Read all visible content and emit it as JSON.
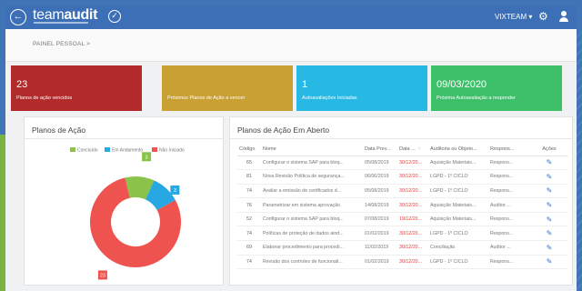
{
  "header": {
    "back_icon": "arrow-left-icon",
    "brand_light": "team",
    "brand_bold": "audit",
    "brand_icon": "check-circle-icon",
    "user_menu": "VIXTEAM ▾",
    "settings_icon": "gear-icon",
    "profile_icon": "person-icon"
  },
  "breadcrumb": "PAINEL PESSOAL >",
  "cards": [
    {
      "number": "23",
      "label": "Planos de ação vencidos",
      "color": "#b32a2a"
    },
    {
      "number": "",
      "label": "Próximos Planos de Ação a vencer",
      "color": "#c9a032"
    },
    {
      "number": "1",
      "label": "Autoavaliações Iniciadas",
      "color": "#27b8e3"
    },
    {
      "number": "09/03/2020",
      "label": "Próxima Autoavaliação a responder",
      "color": "#3ec06b"
    }
  ],
  "chart_panel": {
    "title": "Planos de Ação",
    "chart_data": {
      "type": "donut",
      "series": [
        {
          "name": "Em Andamento",
          "value": 3,
          "color": "#27a8e3"
        },
        {
          "name": "Não Iniciado",
          "value": 23,
          "color": "#ef5350"
        },
        {
          "name": "Concluído",
          "value": 3,
          "color": "#8bc34a"
        }
      ],
      "legend_order": [
        "Concluído",
        "Em Andamento",
        "Não Iniciado"
      ],
      "data_labels": [
        "23",
        "3",
        "3"
      ]
    }
  },
  "table_panel": {
    "title": "Planos de Ação Em Aberto",
    "columns": [
      "Código",
      "Nome",
      "Data Prev...",
      "Data ...",
      "Auditoria ou Objeto...",
      "Respons...",
      "Ações"
    ],
    "action_icon": "edit-pencil-icon",
    "rows": [
      [
        "65",
        "Configurar o sistema SAP para bloq...",
        "05/08/2019",
        "30/12/20...",
        "Aquisição Materiais...",
        "Respons...",
        "✎"
      ],
      [
        "81",
        "Nova Revisão Política de segurança...",
        "06/06/2019",
        "30/12/20...",
        "LGPD - 1º CICLO",
        "Respons...",
        "✎"
      ],
      [
        "74",
        "Avaliar a emissão de certificados d...",
        "05/08/2019",
        "30/12/20...",
        "LGPD - 1º CICLO",
        "Respons...",
        "✎"
      ],
      [
        "76",
        "Parametrizar em sistema aprovação",
        "14/08/2019",
        "30/12/20...",
        "Aquisição Materiais...",
        "Auditor ...",
        "✎"
      ],
      [
        "52",
        "Configurar o sistema SAP para bloq...",
        "07/08/2019",
        "19/12/20...",
        "Aquisição Materiais...",
        "Respons...",
        "✎"
      ],
      [
        "74",
        "Políticas de proteção de dados aind...",
        "01/02/2019",
        "30/12/20...",
        "LGPD - 1º CICLO",
        "Respons...",
        "✎"
      ],
      [
        "69",
        "Elaborar procedimento para procedi...",
        "11/02/2019",
        "30/12/20...",
        "Conciliação",
        "Auditor ...",
        "✎"
      ],
      [
        "74",
        "Revisão dos controles de funcionali...",
        "01/02/2019",
        "30/12/20...",
        "LGPD - 1º CICLO",
        "Respons...",
        "✎"
      ]
    ]
  }
}
